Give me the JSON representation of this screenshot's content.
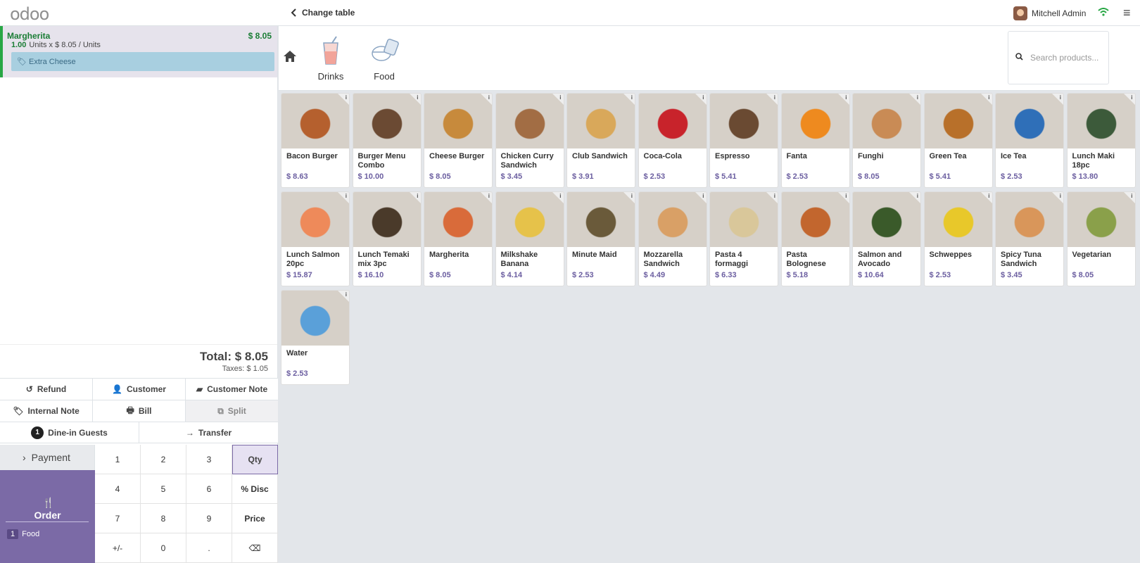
{
  "header": {
    "logo": "odoo",
    "change_table": "Change table",
    "user": "Mitchell Admin"
  },
  "order_line": {
    "name": "Margherita",
    "price": "$ 8.05",
    "qty": "1.00",
    "unit_text": "Units x $ 8.05 / Units",
    "note": "Extra Cheese"
  },
  "totals": {
    "total": "Total: $ 8.05",
    "taxes": "Taxes: $ 1.05"
  },
  "actions": {
    "refund": "Refund",
    "customer": "Customer",
    "customer_note": "Customer Note",
    "internal_note": "Internal Note",
    "bill": "Bill",
    "split": "Split",
    "guests_count": "1",
    "guests": "Dine-in Guests",
    "transfer": "Transfer"
  },
  "pad": {
    "payment": "Payment",
    "order": "Order",
    "order_count": "1",
    "order_category": "Food",
    "keys": [
      "1",
      "2",
      "3",
      "Qty",
      "4",
      "5",
      "6",
      "% Disc",
      "7",
      "8",
      "9",
      "Price",
      "+/-",
      "0",
      ".",
      "⌫"
    ]
  },
  "categories": [
    {
      "label": "Drinks"
    },
    {
      "label": "Food"
    }
  ],
  "search": {
    "placeholder": "Search products..."
  },
  "products": [
    {
      "name": "Bacon Burger",
      "price": "$ 8.63",
      "color": "#b5602e"
    },
    {
      "name": "Burger Menu Combo",
      "price": "$ 10.00",
      "color": "#6b4a33"
    },
    {
      "name": "Cheese Burger",
      "price": "$ 8.05",
      "color": "#c78a3c"
    },
    {
      "name": "Chicken Curry Sandwich",
      "price": "$ 3.45",
      "color": "#a26d44"
    },
    {
      "name": "Club Sandwich",
      "price": "$ 3.91",
      "color": "#d9a85a"
    },
    {
      "name": "Coca-Cola",
      "price": "$ 2.53",
      "color": "#c8232b"
    },
    {
      "name": "Espresso",
      "price": "$ 5.41",
      "color": "#6a4a32"
    },
    {
      "name": "Fanta",
      "price": "$ 2.53",
      "color": "#ee8a1f"
    },
    {
      "name": "Funghi",
      "price": "$ 8.05",
      "color": "#c98b55"
    },
    {
      "name": "Green Tea",
      "price": "$ 5.41",
      "color": "#b8702a"
    },
    {
      "name": "Ice Tea",
      "price": "$ 2.53",
      "color": "#2f6fb8"
    },
    {
      "name": "Lunch Maki 18pc",
      "price": "$ 13.80",
      "color": "#3c5a3a"
    },
    {
      "name": "Lunch Salmon 20pc",
      "price": "$ 15.87",
      "color": "#ee8a5a"
    },
    {
      "name": "Lunch Temaki mix 3pc",
      "price": "$ 16.10",
      "color": "#4a3a2a"
    },
    {
      "name": "Margherita",
      "price": "$ 8.05",
      "color": "#d96b3a"
    },
    {
      "name": "Milkshake Banana",
      "price": "$ 4.14",
      "color": "#e6c24a"
    },
    {
      "name": "Minute Maid",
      "price": "$ 2.53",
      "color": "#6a5a3a"
    },
    {
      "name": "Mozzarella Sandwich",
      "price": "$ 4.49",
      "color": "#d9a066"
    },
    {
      "name": "Pasta 4 formaggi",
      "price": "$ 6.33",
      "color": "#d9c79a"
    },
    {
      "name": "Pasta Bolognese",
      "price": "$ 5.18",
      "color": "#c2662e"
    },
    {
      "name": "Salmon and Avocado",
      "price": "$ 10.64",
      "color": "#3a5a2a"
    },
    {
      "name": "Schweppes",
      "price": "$ 2.53",
      "color": "#e8c82a"
    },
    {
      "name": "Spicy Tuna Sandwich",
      "price": "$ 3.45",
      "color": "#d9965a"
    },
    {
      "name": "Vegetarian",
      "price": "$ 8.05",
      "color": "#8aa04a"
    },
    {
      "name": "Water",
      "price": "$ 2.53",
      "color": "#5aa0d9"
    }
  ]
}
